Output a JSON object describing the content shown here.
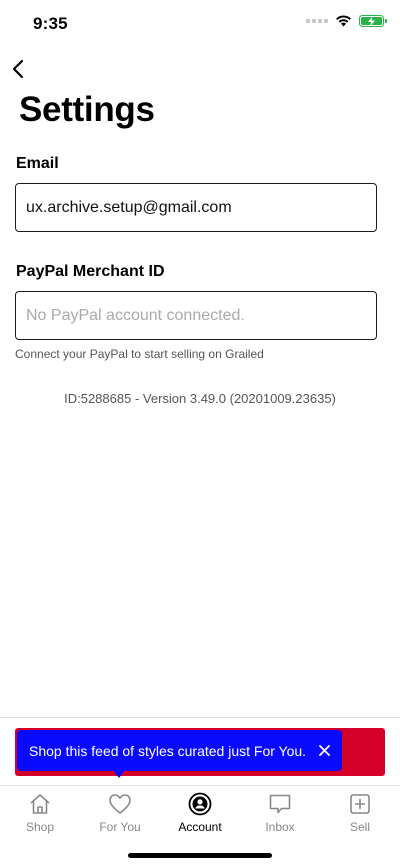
{
  "status_bar": {
    "time": "9:35"
  },
  "page": {
    "title": "Settings"
  },
  "email": {
    "label": "Email",
    "value": "ux.archive.setup@gmail.com"
  },
  "paypal": {
    "label": "PayPal Merchant ID",
    "placeholder": "No PayPal account connected.",
    "helper": "Connect your PayPal to start selling on Grailed"
  },
  "version_info": "ID:5288685 - Version 3.49.0 (20201009.23635)",
  "tooltip": {
    "text": "Shop this feed of styles curated just For You."
  },
  "tab_bar": {
    "items": [
      {
        "label": "Shop",
        "icon": "home-icon"
      },
      {
        "label": "For You",
        "icon": "heart-icon"
      },
      {
        "label": "Account",
        "icon": "account-icon"
      },
      {
        "label": "Inbox",
        "icon": "message-icon"
      },
      {
        "label": "Sell",
        "icon": "plus-square-icon"
      }
    ],
    "active": "Account"
  },
  "colors": {
    "tooltip": "#0a0aff",
    "banner": "#d5002a",
    "battery": "#2ab24a"
  }
}
